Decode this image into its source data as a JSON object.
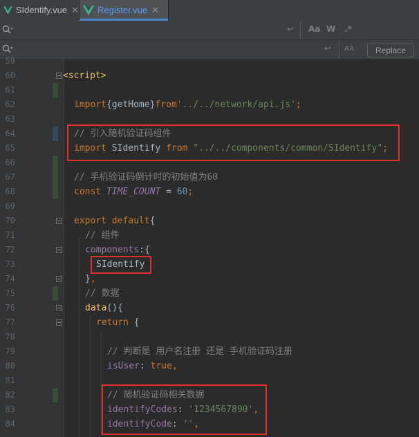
{
  "tabs": [
    {
      "label": "SIdentify.vue",
      "icon": "vue-icon",
      "active": false
    },
    {
      "label": "Register.vue",
      "icon": "vue-icon",
      "active": true
    }
  ],
  "find": {
    "search_placeholder": "",
    "replace_placeholder": "",
    "match_case": "Aa",
    "whole_word": "W",
    "regex": ".*",
    "preserve_case": "AA",
    "replace_button": "Replace"
  },
  "lines": [
    {
      "n": "59",
      "code": ""
    },
    {
      "n": "60",
      "code": "<script>"
    },
    {
      "n": "61",
      "code": ""
    },
    {
      "n": "62",
      "code": "import{getHome}from'../../network/api.js';"
    },
    {
      "n": "63",
      "code": ""
    },
    {
      "n": "64",
      "code": "// 引入随机验证码组件"
    },
    {
      "n": "65",
      "code": "import SIdentify from \"../../components/common/SIdentify\";"
    },
    {
      "n": "66",
      "code": ""
    },
    {
      "n": "67",
      "code": "// 手机验证码倒计时的初始值为60"
    },
    {
      "n": "68",
      "code": "const TIME_COUNT = 60;"
    },
    {
      "n": "69",
      "code": ""
    },
    {
      "n": "70",
      "code": "export default{"
    },
    {
      "n": "71",
      "code": "// 组件"
    },
    {
      "n": "72",
      "code": "components:{"
    },
    {
      "n": "73",
      "code": "SIdentify"
    },
    {
      "n": "74",
      "code": "},"
    },
    {
      "n": "75",
      "code": "// 数据"
    },
    {
      "n": "76",
      "code": "data(){"
    },
    {
      "n": "77",
      "code": "return {"
    },
    {
      "n": "78",
      "code": ""
    },
    {
      "n": "79",
      "code": "// 判断是 用户名注册 还是 手机验证码注册"
    },
    {
      "n": "80",
      "code": "isUser: true,"
    },
    {
      "n": "81",
      "code": ""
    },
    {
      "n": "82",
      "code": "// 随机验证码相关数据"
    },
    {
      "n": "83",
      "code": "identifyCodes: '1234567890',"
    },
    {
      "n": "84",
      "code": "identifyCode: '',"
    }
  ],
  "tokens": {
    "script_tag": "<script>",
    "import": "import",
    "getHome": "getHome",
    "from": "from",
    "api_path": "'../../network/api.js'",
    "comment_import": "// 引入随机验证码组件",
    "SIdentify": "SIdentify",
    "sid_path": "\"../../components/common/SIdentify\"",
    "comment_countdown": "// 手机验证码倒计时的初始值为60",
    "const": "const",
    "TIME_COUNT": "TIME_COUNT",
    "sixty": "60",
    "export": "export",
    "default": "default",
    "comment_components": "// 组件",
    "components": "components",
    "comment_data": "// 数据",
    "data": "data",
    "return": "return",
    "comment_isuser": "// 判断是 用户名注册 还是 手机验证码注册",
    "isUser": "isUser",
    "true": "true",
    "comment_identify": "// 随机验证码相关数据",
    "identifyCodes": "identifyCodes",
    "codes_value": "'1234567890'",
    "identifyCode": "identifyCode",
    "empty_str": "''"
  },
  "colors": {
    "keyword": "#cc7832",
    "string": "#6a8759",
    "number": "#6897bb",
    "comment": "#808080",
    "property": "#9876aa",
    "highlight_box": "#e0302b",
    "active_tab_text": "#589df6"
  }
}
